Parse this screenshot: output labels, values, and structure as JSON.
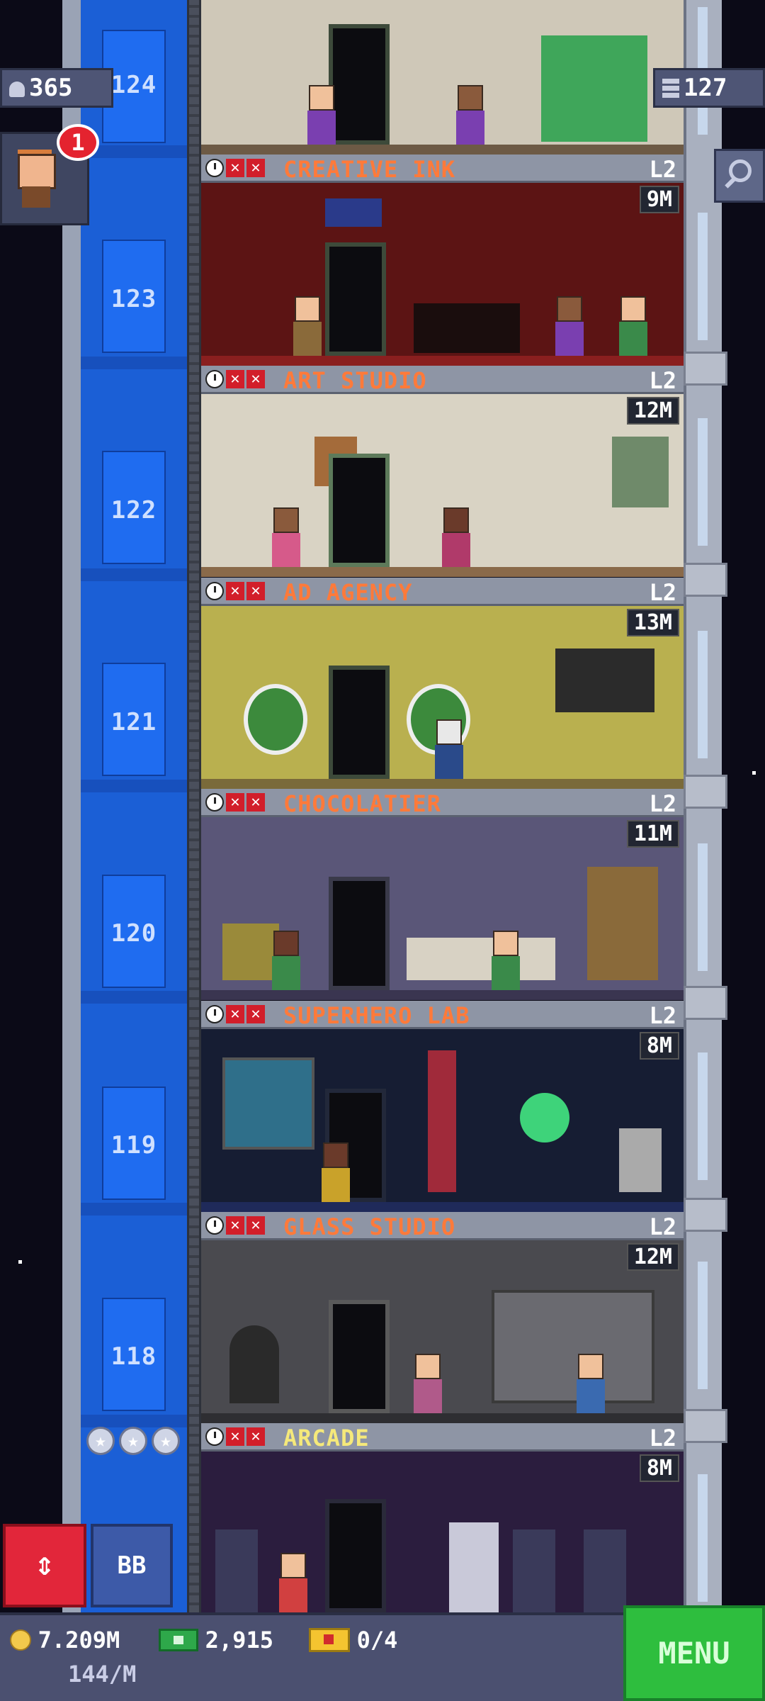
{
  "hud": {
    "population": "365",
    "floor_count": "127",
    "notification_count": "1"
  },
  "shaft_floor_numbers": [
    "124",
    "123",
    "122",
    "121",
    "120",
    "119",
    "118"
  ],
  "floors": [
    {
      "name": "CREATIVE INK",
      "level": "L2",
      "price": "9M",
      "name_color": "orange",
      "room_color": "#5c1414",
      "accent": "#d94b3a"
    },
    {
      "name": "ART STUDIO",
      "level": "L2",
      "price": "12M",
      "name_color": "orange",
      "room_color": "#d9d3c4",
      "accent": "#7fa36b"
    },
    {
      "name": "AD AGENCY",
      "level": "L2",
      "price": "13M",
      "name_color": "orange",
      "room_color": "#b9b04f",
      "accent": "#3c8a3c"
    },
    {
      "name": "CHOCOLATIER",
      "level": "L2",
      "price": "11M",
      "name_color": "orange",
      "room_color": "#5a5678",
      "accent": "#8a5a2a"
    },
    {
      "name": "SUPERHERO LAB",
      "level": "L2",
      "price": "8M",
      "name_color": "orange",
      "room_color": "#161d33",
      "accent": "#3ed37a"
    },
    {
      "name": "GLASS STUDIO",
      "level": "L2",
      "price": "12M",
      "name_color": "orange",
      "room_color": "#4a4a4f",
      "accent": "#d6a23a"
    },
    {
      "name": "ARCADE",
      "level": "L2",
      "price": "8M",
      "name_color": "yellow",
      "room_color": "#2b1d3e",
      "accent": "#d14040"
    }
  ],
  "elevator_button": {
    "label": "⇕"
  },
  "bb_button": {
    "label": "BB"
  },
  "bottom_bar": {
    "coins": "7.209M",
    "income": "144/M",
    "tower_bux": "2,915",
    "tickets": "0/4"
  },
  "menu_button": {
    "label": "MENU"
  },
  "colors": {
    "shaft_blue": "#1b5fd6",
    "name_orange": "#ff7a3a",
    "name_yellow": "#f5e97a",
    "menu_green": "#2ebe3e",
    "elevator_red": "#e2263a"
  }
}
